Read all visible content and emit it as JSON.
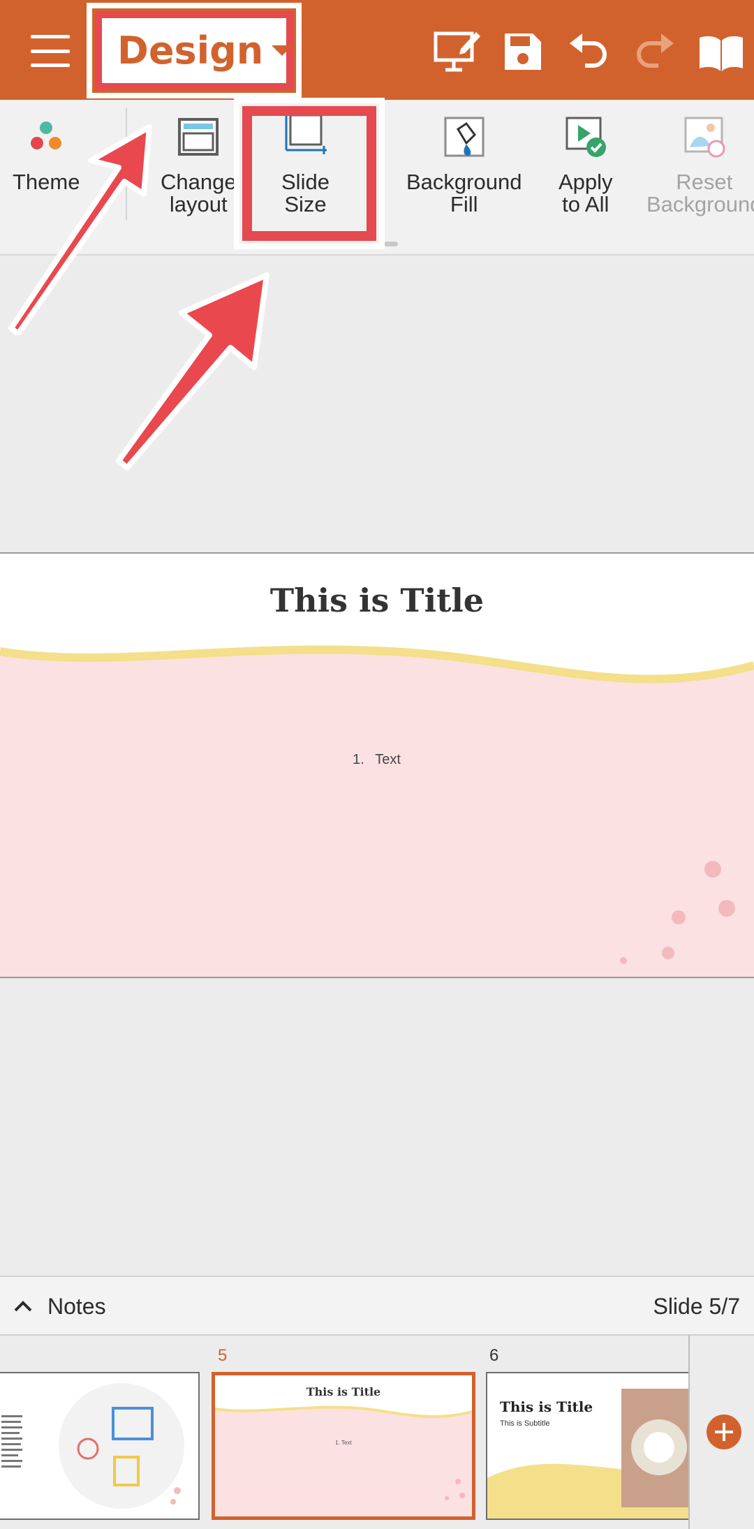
{
  "appbar": {
    "tab_label": "Design",
    "icons": [
      "menu-icon",
      "slideshow-edit-icon",
      "save-icon",
      "undo-icon",
      "redo-icon",
      "read-mode-icon"
    ],
    "color": "#d2622d"
  },
  "ribbon": {
    "items": [
      {
        "label": "Theme",
        "icon": "theme-icon"
      },
      {
        "label": "Change\nlayout",
        "icon": "layout-icon"
      },
      {
        "label": "Slide\nSize",
        "icon": "slide-size-icon"
      },
      {
        "label": "Background\nFill",
        "icon": "background-fill-icon"
      },
      {
        "label": "Apply\nto All",
        "icon": "apply-to-all-icon"
      },
      {
        "label": "Reset\nBackground",
        "icon": "reset-background-icon",
        "disabled": true
      }
    ]
  },
  "slide": {
    "title": "This is Title",
    "list_marker": "1.",
    "body_text": "Text"
  },
  "notes": {
    "label": "Notes",
    "counter": "Slide 5/7"
  },
  "thumbnails": [
    {
      "number": "",
      "title": ""
    },
    {
      "number": "5",
      "title": "This is Title",
      "body": "1.  Text",
      "active": true
    },
    {
      "number": "6",
      "title": "This is Title",
      "subtitle": "This is Subtitle"
    }
  ],
  "annotations": {
    "highlight_color": "#e44a4f"
  }
}
